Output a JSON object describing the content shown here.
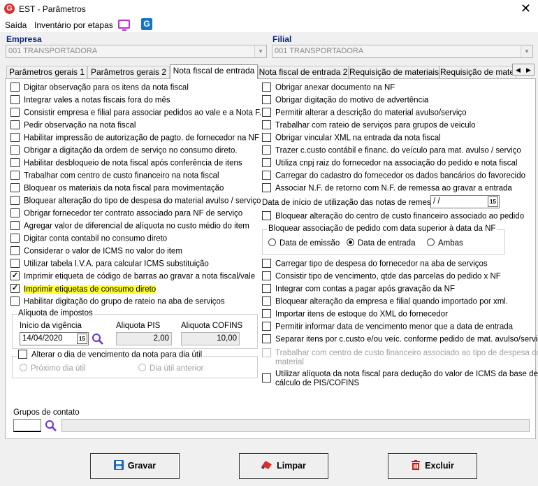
{
  "window": {
    "title": "EST - Parâmetros",
    "close_glyph": "✕"
  },
  "menu": {
    "items": [
      "Saída",
      "Inventário por etapas"
    ],
    "icons": [
      "monitor-icon",
      "g-app-icon"
    ]
  },
  "empresa": {
    "label": "Empresa",
    "value": "001 TRANSPORTADORA"
  },
  "filial": {
    "label": "Filial",
    "value": "001 TRANSPORTADORA"
  },
  "tabs": [
    "Parâmetros gerais 1",
    "Parâmetros gerais 2",
    "Nota fiscal de entrada",
    "Nota fiscal de entrada 2",
    "Requisição de materiais",
    "Requisição de materi"
  ],
  "active_tab": "Nota fiscal de entrada",
  "left_options": [
    {
      "label": "Digitar observação para os itens da nota fiscal",
      "checked": false
    },
    {
      "label": "Integrar vales a notas fiscais fora do mês",
      "checked": false
    },
    {
      "label": "Consistir empresa e filial para associar pedidos ao vale e a Nota F.",
      "checked": false
    },
    {
      "label": "Pedir observação na nota fiscal",
      "checked": false
    },
    {
      "label": "Habilitar impressão de autorização de pagto. de fornecedor na NF",
      "checked": false
    },
    {
      "label": "Obrigar a digitação da ordem de serviço no consumo direto.",
      "checked": false
    },
    {
      "label": "Habilitar desbloqueio de nota fiscal após conferência de itens",
      "checked": false
    },
    {
      "label": "Trabalhar com centro de custo financeiro na nota fiscal",
      "checked": false
    },
    {
      "label": "Bloquear os materiais da nota fiscal para movimentação",
      "checked": false
    },
    {
      "label": "Bloquear alteração do tipo de despesa do material avulso / serviço",
      "checked": false
    },
    {
      "label": "Obrigar fornecedor ter contrato associado para NF de serviço",
      "checked": false
    },
    {
      "label": "Agregar valor de diferencial de alíquota no custo médio do item",
      "checked": false
    },
    {
      "label": "Digitar conta contabil no consumo direto",
      "checked": false
    },
    {
      "label": "Considerar o valor de ICMS no valor do item",
      "checked": false
    },
    {
      "label": "Utilizar tabela I.V.A. para calcular ICMS substituição",
      "checked": false
    },
    {
      "label": "Imprimir etiqueta de código de barras ao gravar a nota fiscal/vale",
      "checked": true
    },
    {
      "label": "Imprimir etiquetas de consumo direto",
      "checked": true,
      "highlighted": true
    },
    {
      "label": "Habilitar digitação do grupo de rateio na aba de serviços",
      "checked": false
    }
  ],
  "aliquota": {
    "title": "Aliquota de impostos",
    "inicio_label": "Início da vigência",
    "inicio_value": "14/04/2020",
    "pis_label": "Aliquota PIS",
    "pis_value": "2,00",
    "cofins_label": "Aliquota COFINS",
    "cofins_value": "10,00",
    "calendar_glyph": "15"
  },
  "vencimento": {
    "label": "Alterar o dia de vencimento da nota para dia útil",
    "option1": "Próximo dia útil",
    "option2": "Dia útil anterior"
  },
  "right_options_top": [
    {
      "label": "Obrigar anexar documento na NF",
      "checked": false
    },
    {
      "label": "Obrigar digitação do motivo de advertência",
      "checked": false
    },
    {
      "label": "Permitir alterar a descrição do material avulso/serviço",
      "checked": false
    },
    {
      "label": "Trabalhar com rateio de serviços para grupos de veiculo",
      "checked": false
    },
    {
      "label": "Obrigar vincular XML na entrada da nota fiscal",
      "checked": false
    },
    {
      "label": "Trazer c.custo contábil e financ. do veículo para mat. avulso / serviço",
      "checked": false
    },
    {
      "label": "Utiliza cnpj raiz do fornecedor na associação do pedido e nota fiscal",
      "checked": false
    },
    {
      "label": "Carregar do cadastro do fornecedor os dados bancários do favorecido",
      "checked": false
    },
    {
      "label": "Associar N.F. de retorno com N.F. de remessa ao gravar a entrada",
      "checked": false
    }
  ],
  "data_inicio_remessa": {
    "label": "Data de início de utilização das notas de remessa",
    "value": " /  /"
  },
  "bloquear_ccusto": {
    "label": "Bloquear alteração do centro de custo financeiro associado ao pedido",
    "checked": false
  },
  "bloquear_pedido": {
    "title": "Bloquear associação de pedido com data superior à data da NF",
    "options": [
      "Data de emissão",
      "Data de entrada",
      "Ambas"
    ],
    "selected": "Data de entrada"
  },
  "right_options_bottom": [
    {
      "label": "Carregar tipo de despesa do fornecedor na aba de serviços",
      "checked": false
    },
    {
      "label": "Consistir tipo de vencimento, qtde das parcelas do pedido x NF",
      "checked": false
    },
    {
      "label": "Integrar com contas a pagar após gravação da NF",
      "checked": false
    },
    {
      "label": "Bloquear alteração da empresa e filial quando importado por xml.",
      "checked": false
    },
    {
      "label": "Importar itens de estoque do XML do fornecedor",
      "checked": false
    },
    {
      "label": "Permitir informar data de vencimento menor que a data de entrada",
      "checked": false
    },
    {
      "label": "Separar itens por c.custo e/ou veíc. conforme pedido de mat. avulso/serviço",
      "checked": false
    }
  ],
  "trabalhar_ccusto_tipo": {
    "line1": "Trabalhar com centro de custo financeiro associado ao tipo de despesa do",
    "line2": "material"
  },
  "utilizar_aliquota": {
    "line1": "Utilizar alíquota da nota fiscal para dedução do valor de ICMS da base de",
    "line2": "cálculo de PIS/COFINS"
  },
  "grupos_contato": {
    "label": "Grupos de contato",
    "code": "",
    "description": ""
  },
  "buttons": {
    "gravar": "Gravar",
    "limpar": "Limpar",
    "excluir": "Excluir"
  },
  "colors": {
    "highlight": "#ffff33",
    "accent_label": "#0a2a7a",
    "gravar_icon": "#1e63c4",
    "limpar_icon": "#e02b2b",
    "excluir_icon": "#d01414"
  }
}
